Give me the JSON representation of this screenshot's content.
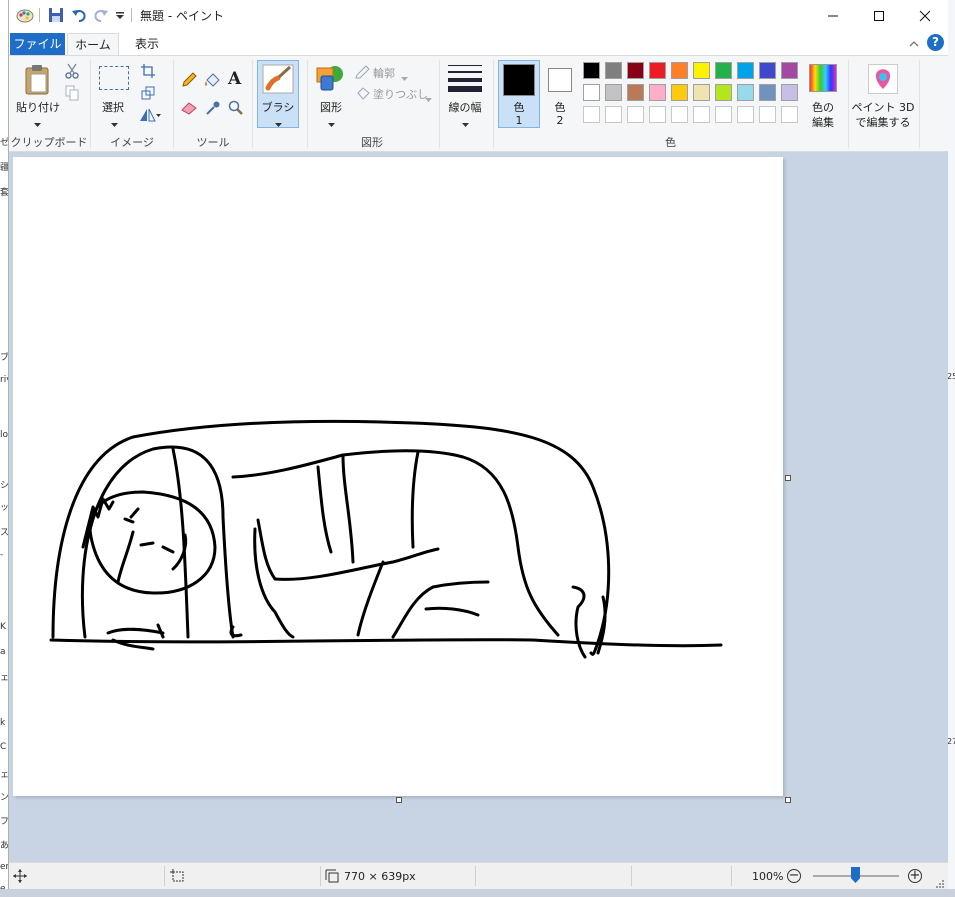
{
  "window": {
    "title": "無題 - ペイント"
  },
  "tabs": {
    "file": "ファイル",
    "home": "ホーム",
    "view": "表示"
  },
  "ribbon": {
    "clipboard": {
      "paste": "貼り付け",
      "label": "クリップボード"
    },
    "image": {
      "select": "選択",
      "label": "イメージ"
    },
    "tools": {
      "label": "ツール"
    },
    "brush": {
      "label": "ブラシ"
    },
    "shapes": {
      "shape": "図形",
      "outline": "輪郭",
      "fill": "塗りつぶし",
      "label": "図形"
    },
    "size": {
      "label": "線の幅"
    },
    "colors": {
      "color1": "色",
      "color1_num": "1",
      "color2": "色",
      "color2_num": "2",
      "label": "色",
      "edit_line1": "色の",
      "edit_line2": "編集",
      "color1_value": "#000000",
      "color2_value": "#ffffff",
      "palette_row1": [
        "#000000",
        "#7f7f7f",
        "#880015",
        "#ed1c24",
        "#ff7f27",
        "#fff200",
        "#22b14c",
        "#00a2e8",
        "#3f48cc",
        "#a349a4"
      ],
      "palette_row2": [
        "#ffffff",
        "#c3c3c3",
        "#b97a57",
        "#ffaec9",
        "#ffc90e",
        "#efe4b0",
        "#b5e61d",
        "#99d9ea",
        "#7092be",
        "#c8bfe7"
      ],
      "palette_row3": [
        "#ffffff",
        "#ffffff",
        "#ffffff",
        "#ffffff",
        "#ffffff",
        "#ffffff",
        "#ffffff",
        "#ffffff",
        "#ffffff",
        "#ffffff"
      ]
    },
    "paint3d": {
      "line1": "ペイント 3D",
      "line2": "で編集する"
    }
  },
  "statusbar": {
    "dimensions": "770 × 639px",
    "zoom": "100%"
  },
  "background_fragments": {
    "left": [
      "ゼ",
      "疆",
      "套",
      "ブ",
      "riv",
      "lo",
      "シ",
      "ッ",
      "ス",
      "-",
      "K",
      "a",
      "ェ",
      "k",
      "C",
      "ェ",
      "ン",
      "フ",
      "あ",
      "er",
      "e"
    ],
    "right": [
      "25",
      "27"
    ]
  }
}
